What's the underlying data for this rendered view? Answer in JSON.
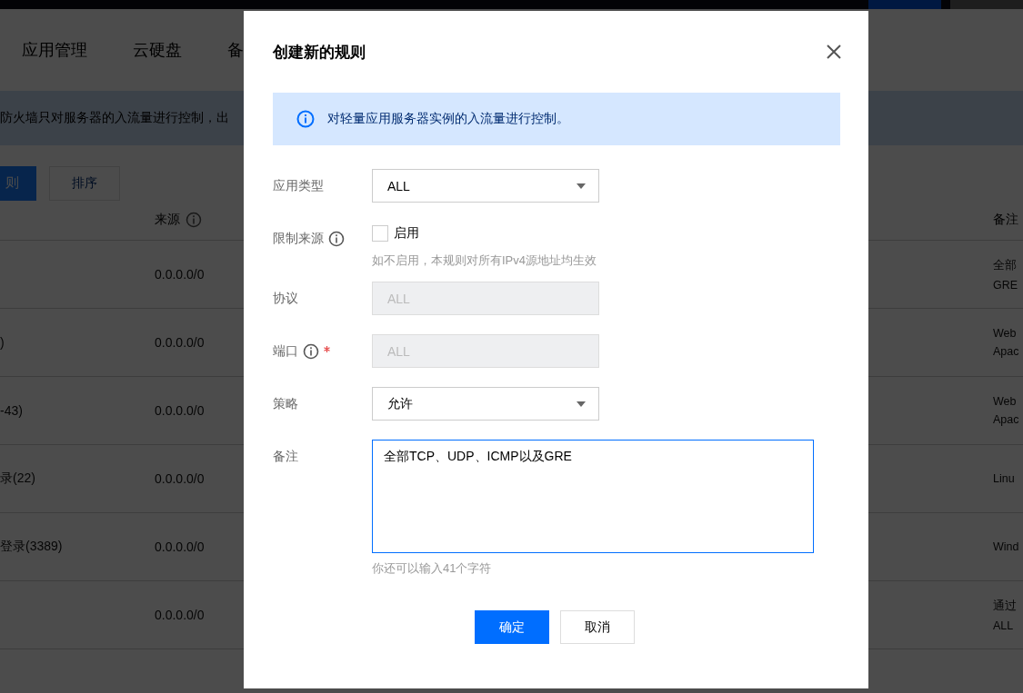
{
  "page": {
    "tabs": [
      {
        "label": "应用管理",
        "selected": false
      },
      {
        "label": "云硬盘",
        "selected": false
      },
      {
        "label": "备",
        "selected": false
      }
    ],
    "notice": "防火墙只对服务器的入流量进行控制，出",
    "toolbar": [
      {
        "label": "则",
        "kind": "primary"
      },
      {
        "label": "排序",
        "kind": "default"
      }
    ],
    "table": {
      "columns": [
        "",
        "来源",
        "备注"
      ],
      "rows": [
        {
          "column_1": "",
          "source": "0.0.0.0/0",
          "note": [
            "全部",
            "GRE"
          ]
        },
        {
          "column_1": ")",
          "source": "0.0.0.0/0",
          "note": [
            "Web",
            "Apac"
          ]
        },
        {
          "column_1": "-43)",
          "source": "0.0.0.0/0",
          "note": [
            "Web",
            "Apac"
          ]
        },
        {
          "column_1": "录(22)",
          "source": "0.0.0.0/0",
          "note": [
            "Linu"
          ]
        },
        {
          "column_1": "登录(3389)",
          "source": "0.0.0.0/0",
          "note": [
            "Wind"
          ]
        },
        {
          "column_1": "",
          "source": "0.0.0.0/0",
          "note": [
            "通过",
            "ALL"
          ]
        }
      ]
    }
  },
  "dialog": {
    "title": "创建新的规则",
    "info": "对轻量应用服务器实例的入流量进行控制。",
    "fields": [
      {
        "label": "应用类型",
        "kind": "select",
        "value": "ALL",
        "info_icon": false,
        "required": false,
        "disabled": false
      },
      {
        "label": "限制来源",
        "kind": "checkbox",
        "option": "启用",
        "checked": false,
        "hint": "如不启用，本规则对所有IPv4源地址均生效",
        "info_icon": true,
        "required": false
      },
      {
        "label": "协议",
        "kind": "input",
        "value": "ALL",
        "info_icon": false,
        "required": false,
        "disabled": true
      },
      {
        "label": "端口",
        "kind": "input",
        "value": "ALL",
        "info_icon": true,
        "required": true,
        "disabled": true
      },
      {
        "label": "策略",
        "kind": "select",
        "value": "允许",
        "info_icon": false,
        "required": false,
        "disabled": false
      },
      {
        "label": "备注",
        "kind": "textarea",
        "value": "全部TCP、UDP、ICMP以及GRE",
        "hint": "你还可以输入41个字符",
        "info_icon": false,
        "required": false
      }
    ],
    "buttons": [
      {
        "label": "确定",
        "kind": "primary"
      },
      {
        "label": "取消",
        "kind": "default"
      }
    ]
  }
}
